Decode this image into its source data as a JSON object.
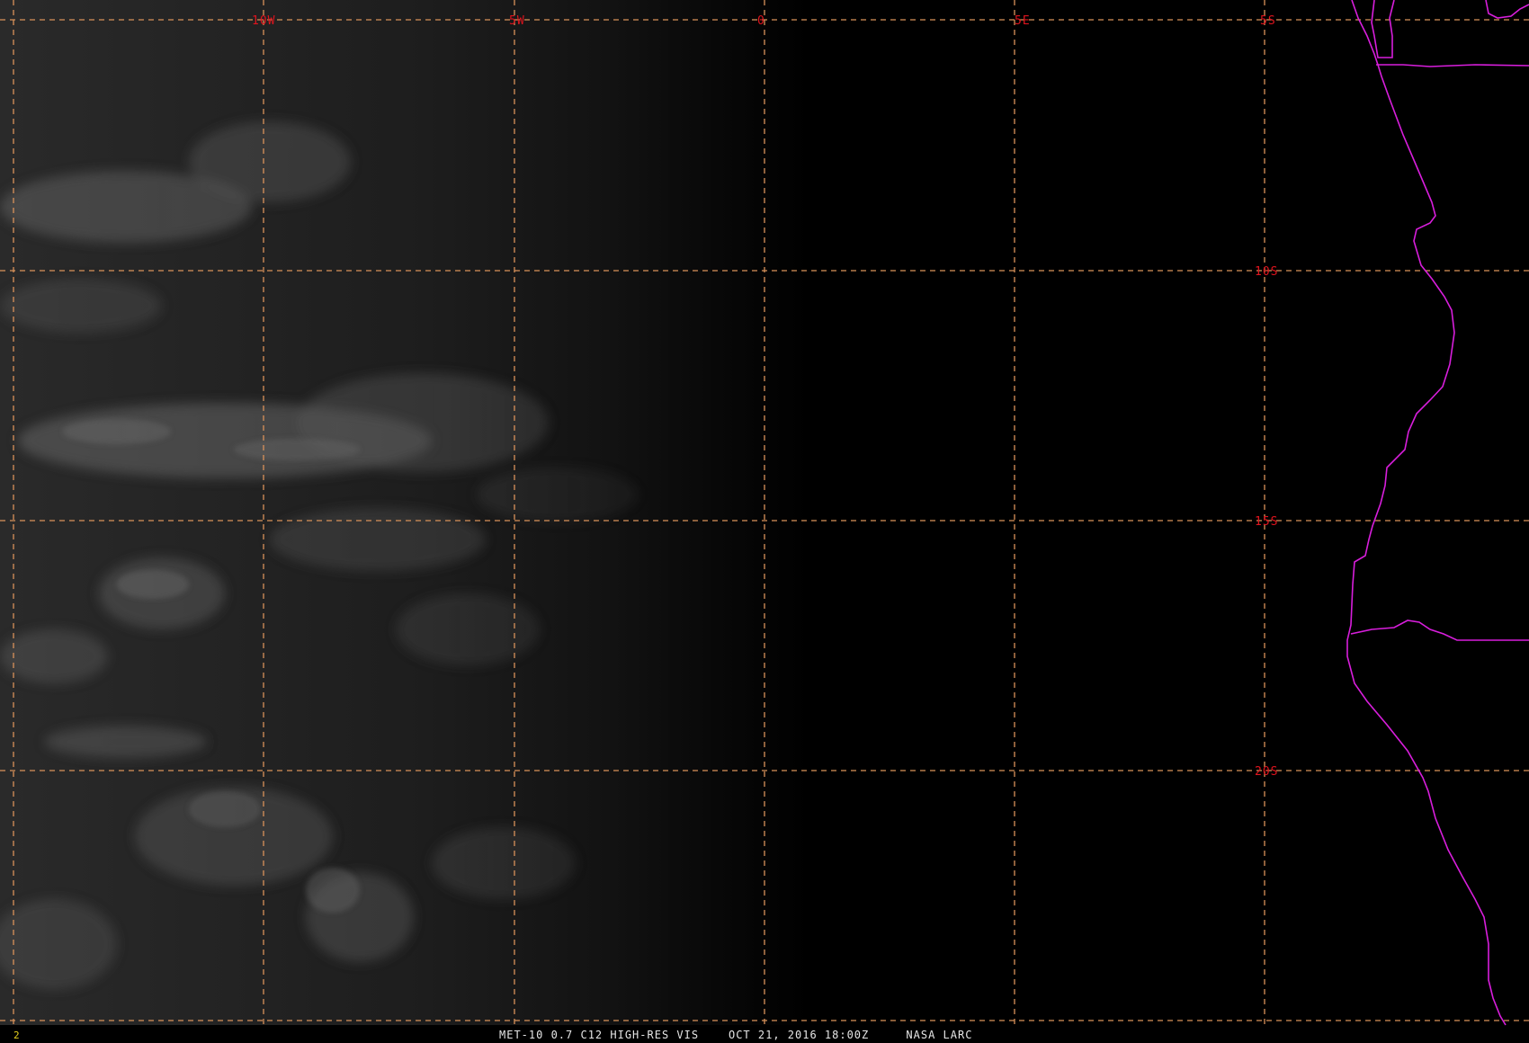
{
  "image": {
    "product": "MET-10 0.7 C12 HIGH-RES VIS",
    "datetime": "OCT 21, 2016 18:00Z",
    "credit": "NASA LARC",
    "frame_number": "2"
  },
  "grid": {
    "longitude_labels": [
      "10W",
      "5W",
      "0",
      "5E"
    ],
    "latitude_labels": [
      "5S",
      "10S",
      "15S",
      "20S"
    ],
    "line_color": "#d9925a",
    "label_color": "#e0141e"
  },
  "map_overlay": {
    "boundaries_color": "#d81edc",
    "region": "South Atlantic / SW Africa coast"
  }
}
